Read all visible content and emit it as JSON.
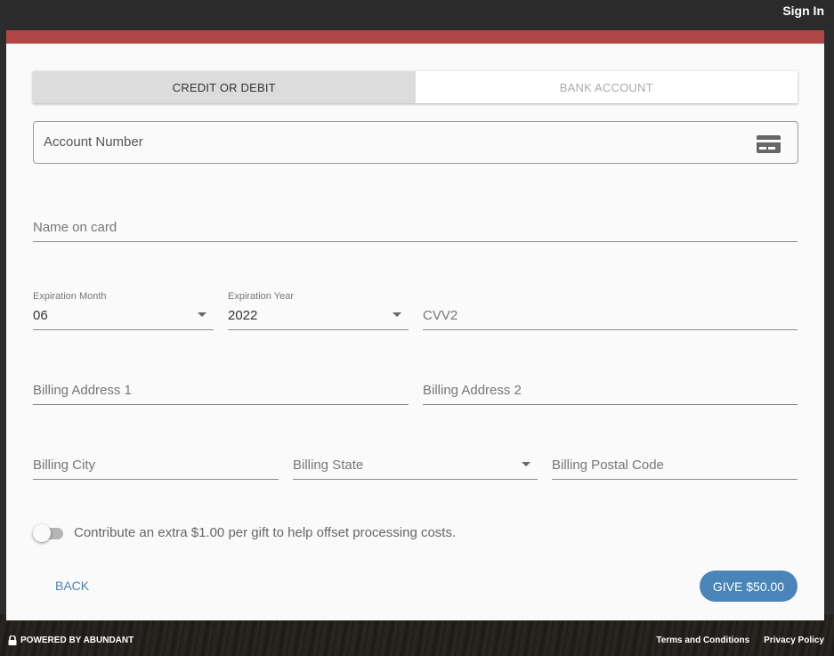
{
  "header": {
    "sign_in": "Sign In"
  },
  "tabs": [
    {
      "label": "CREDIT OR DEBIT",
      "active": true
    },
    {
      "label": "BANK ACCOUNT",
      "active": false
    }
  ],
  "form": {
    "account_number": "Account Number",
    "name_on_card": "Name on card",
    "expiration_month": {
      "label": "Expiration Month",
      "value": "06"
    },
    "expiration_year": {
      "label": "Expiration Year",
      "value": "2022"
    },
    "cvv2": "CVV2",
    "billing_address_1": "Billing Address 1",
    "billing_address_2": "Billing Address 2",
    "billing_city": "Billing City",
    "billing_state": "Billing State",
    "billing_postal_code": "Billing Postal Code"
  },
  "processing_toggle": {
    "label": "Contribute an extra $1.00 per gift to help offset processing costs.",
    "checked": false
  },
  "actions": {
    "back": "BACK",
    "give": "GIVE $50.00"
  },
  "footer": {
    "powered_by": "POWERED BY ABUNDANT",
    "terms": "Terms and Conditions",
    "privacy": "Privacy Policy"
  },
  "colors": {
    "accent_bar": "#b04646",
    "primary_button": "#4985b8",
    "link": "#4a84b5"
  },
  "icons": {
    "card_icon": "credit-card-icon",
    "lock_icon": "lock-icon"
  }
}
